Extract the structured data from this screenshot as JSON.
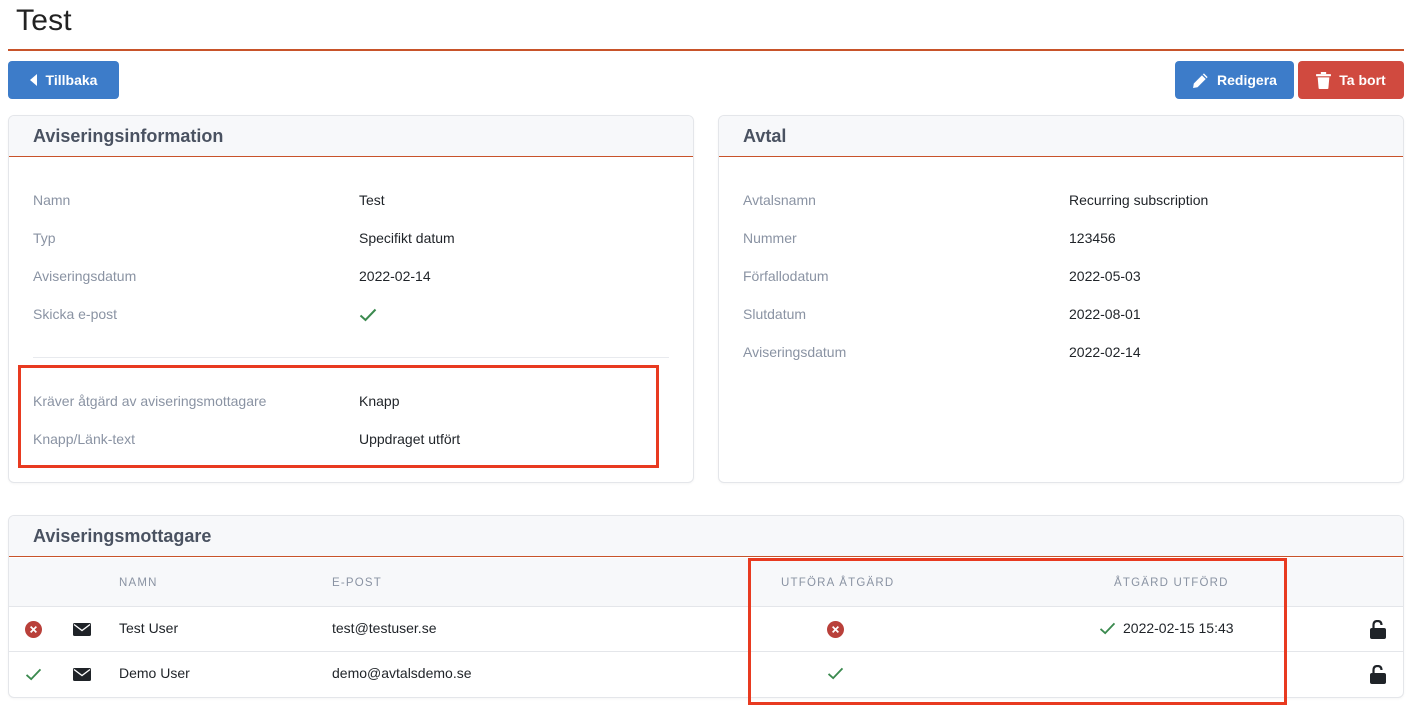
{
  "page": {
    "title": "Test"
  },
  "toolbar": {
    "back_label": "Tillbaka",
    "edit_label": "Redigera",
    "delete_label": "Ta bort"
  },
  "info": {
    "title": "Aviseringsinformation",
    "name_label": "Namn",
    "name_value": "Test",
    "type_label": "Typ",
    "type_value": "Specifikt datum",
    "date_label": "Aviseringsdatum",
    "date_value": "2022-02-14",
    "email_label": "Skicka e-post",
    "action_label": "Kräver åtgärd av aviseringsmottagare",
    "action_value": "Knapp",
    "linktext_label": "Knapp/Länk-text",
    "linktext_value": "Uppdraget utfört"
  },
  "contract": {
    "title": "Avtal",
    "name_label": "Avtalsnamn",
    "name_value": "Recurring subscription",
    "number_label": "Nummer",
    "number_value": "123456",
    "due_label": "Förfallodatum",
    "due_value": "2022-05-03",
    "end_label": "Slutdatum",
    "end_value": "2022-08-01",
    "notify_label": "Aviseringsdatum",
    "notify_value": "2022-02-14"
  },
  "recipients": {
    "title": "Aviseringsmottagare",
    "columns": {
      "name": "NAMN",
      "email": "E-POST",
      "do_action": "UTFÖRA ÅTGÄRD",
      "action_done": "ÅTGÄRD UTFÖRD"
    },
    "rows": [
      {
        "name": "Test User",
        "email": "test@testuser.se",
        "action_done": "2022-02-15 15:43"
      },
      {
        "name": "Demo User",
        "email": "demo@avtalsdemo.se",
        "action_done": ""
      }
    ]
  },
  "colors": {
    "primary": "#3d7cc9",
    "danger": "#d04a3f",
    "accent_rule": "#c8532a",
    "success": "#3b8a4f",
    "highlight": "#e83a20"
  },
  "icons": [
    "caret-left-icon",
    "pencil-icon",
    "trash-icon",
    "check-icon",
    "error-circle-icon",
    "envelope-icon",
    "unlock-icon"
  ]
}
